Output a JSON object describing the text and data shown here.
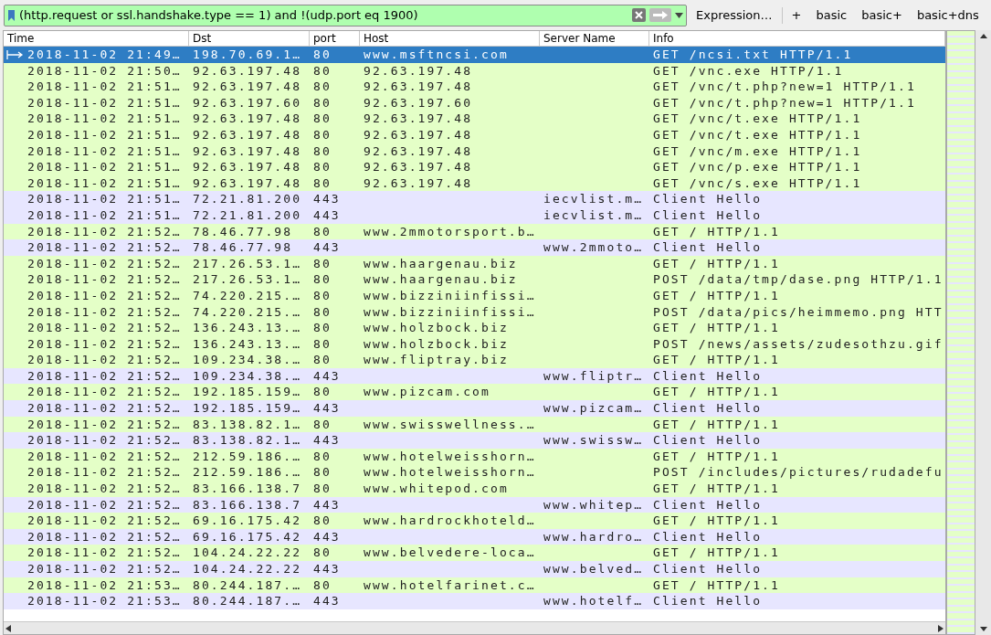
{
  "filter_bar": {
    "value": "(http.request or ssl.handshake.type == 1) and !(udp.port eq 1900)",
    "buttons": [
      {
        "label": "Expression…"
      },
      {
        "label": "+"
      },
      {
        "label": "basic"
      },
      {
        "label": "basic+"
      },
      {
        "label": "basic+dns"
      }
    ]
  },
  "table": {
    "columns": [
      "Time",
      "Dst",
      "port",
      "Host",
      "Server Name",
      "Info"
    ],
    "rows": [
      {
        "kind": "http",
        "selected": true,
        "cells": [
          "2018-11-02 21:49…",
          "198.70.69.1…",
          "80",
          "www.msftncsi.com",
          "",
          "GET /ncsi.txt HTTP/1.1"
        ]
      },
      {
        "kind": "http",
        "selected": false,
        "cells": [
          "2018-11-02 21:50…",
          "92.63.197.48",
          "80",
          "92.63.197.48",
          "",
          "GET /vnc.exe HTTP/1.1"
        ]
      },
      {
        "kind": "http",
        "selected": false,
        "cells": [
          "2018-11-02 21:51…",
          "92.63.197.48",
          "80",
          "92.63.197.48",
          "",
          "GET /vnc/t.php?new=1 HTTP/1.1"
        ]
      },
      {
        "kind": "http",
        "selected": false,
        "cells": [
          "2018-11-02 21:51…",
          "92.63.197.60",
          "80",
          "92.63.197.60",
          "",
          "GET /vnc/t.php?new=1 HTTP/1.1"
        ]
      },
      {
        "kind": "http",
        "selected": false,
        "cells": [
          "2018-11-02 21:51…",
          "92.63.197.48",
          "80",
          "92.63.197.48",
          "",
          "GET /vnc/t.exe HTTP/1.1"
        ]
      },
      {
        "kind": "http",
        "selected": false,
        "cells": [
          "2018-11-02 21:51…",
          "92.63.197.48",
          "80",
          "92.63.197.48",
          "",
          "GET /vnc/t.exe HTTP/1.1"
        ]
      },
      {
        "kind": "http",
        "selected": false,
        "cells": [
          "2018-11-02 21:51…",
          "92.63.197.48",
          "80",
          "92.63.197.48",
          "",
          "GET /vnc/m.exe HTTP/1.1"
        ]
      },
      {
        "kind": "http",
        "selected": false,
        "cells": [
          "2018-11-02 21:51…",
          "92.63.197.48",
          "80",
          "92.63.197.48",
          "",
          "GET /vnc/p.exe HTTP/1.1"
        ]
      },
      {
        "kind": "http",
        "selected": false,
        "cells": [
          "2018-11-02 21:51…",
          "92.63.197.48",
          "80",
          "92.63.197.48",
          "",
          "GET /vnc/s.exe HTTP/1.1"
        ]
      },
      {
        "kind": "tls",
        "selected": false,
        "cells": [
          "2018-11-02 21:51…",
          "72.21.81.200",
          "443",
          "",
          "iecvlist.m…",
          "Client Hello"
        ]
      },
      {
        "kind": "tls",
        "selected": false,
        "cells": [
          "2018-11-02 21:51…",
          "72.21.81.200",
          "443",
          "",
          "iecvlist.m…",
          "Client Hello"
        ]
      },
      {
        "kind": "http",
        "selected": false,
        "cells": [
          "2018-11-02 21:52…",
          "78.46.77.98",
          "80",
          "www.2mmotorsport.b…",
          "",
          "GET / HTTP/1.1"
        ]
      },
      {
        "kind": "tls",
        "selected": false,
        "cells": [
          "2018-11-02 21:52…",
          "78.46.77.98",
          "443",
          "",
          "www.2mmoto…",
          "Client Hello"
        ]
      },
      {
        "kind": "http",
        "selected": false,
        "cells": [
          "2018-11-02 21:52…",
          "217.26.53.1…",
          "80",
          "www.haargenau.biz",
          "",
          "GET / HTTP/1.1"
        ]
      },
      {
        "kind": "http",
        "selected": false,
        "cells": [
          "2018-11-02 21:52…",
          "217.26.53.1…",
          "80",
          "www.haargenau.biz",
          "",
          "POST /data/tmp/dase.png HTTP/1.1"
        ]
      },
      {
        "kind": "http",
        "selected": false,
        "cells": [
          "2018-11-02 21:52…",
          "74.220.215.…",
          "80",
          "www.bizziniinfissi…",
          "",
          "GET / HTTP/1.1"
        ]
      },
      {
        "kind": "http",
        "selected": false,
        "cells": [
          "2018-11-02 21:52…",
          "74.220.215.…",
          "80",
          "www.bizziniinfissi…",
          "",
          "POST /data/pics/heimmemo.png HTT"
        ]
      },
      {
        "kind": "http",
        "selected": false,
        "cells": [
          "2018-11-02 21:52…",
          "136.243.13.…",
          "80",
          "www.holzbock.biz",
          "",
          "GET / HTTP/1.1"
        ]
      },
      {
        "kind": "http",
        "selected": false,
        "cells": [
          "2018-11-02 21:52…",
          "136.243.13.…",
          "80",
          "www.holzbock.biz",
          "",
          "POST /news/assets/zudesothzu.gif"
        ]
      },
      {
        "kind": "http",
        "selected": false,
        "cells": [
          "2018-11-02 21:52…",
          "109.234.38.…",
          "80",
          "www.fliptray.biz",
          "",
          "GET / HTTP/1.1"
        ]
      },
      {
        "kind": "tls",
        "selected": false,
        "cells": [
          "2018-11-02 21:52…",
          "109.234.38.…",
          "443",
          "",
          "www.fliptr…",
          "Client Hello"
        ]
      },
      {
        "kind": "http",
        "selected": false,
        "cells": [
          "2018-11-02 21:52…",
          "192.185.159…",
          "80",
          "www.pizcam.com",
          "",
          "GET / HTTP/1.1"
        ]
      },
      {
        "kind": "tls",
        "selected": false,
        "cells": [
          "2018-11-02 21:52…",
          "192.185.159…",
          "443",
          "",
          "www.pizcam…",
          "Client Hello"
        ]
      },
      {
        "kind": "http",
        "selected": false,
        "cells": [
          "2018-11-02 21:52…",
          "83.138.82.1…",
          "80",
          "www.swisswellness.…",
          "",
          "GET / HTTP/1.1"
        ]
      },
      {
        "kind": "tls",
        "selected": false,
        "cells": [
          "2018-11-02 21:52…",
          "83.138.82.1…",
          "443",
          "",
          "www.swissw…",
          "Client Hello"
        ]
      },
      {
        "kind": "http",
        "selected": false,
        "cells": [
          "2018-11-02 21:52…",
          "212.59.186.…",
          "80",
          "www.hotelweisshorn…",
          "",
          "GET / HTTP/1.1"
        ]
      },
      {
        "kind": "http",
        "selected": false,
        "cells": [
          "2018-11-02 21:52…",
          "212.59.186.…",
          "80",
          "www.hotelweisshorn…",
          "",
          "POST /includes/pictures/rudadefu"
        ]
      },
      {
        "kind": "http",
        "selected": false,
        "cells": [
          "2018-11-02 21:52…",
          "83.166.138.7",
          "80",
          "www.whitepod.com",
          "",
          "GET / HTTP/1.1"
        ]
      },
      {
        "kind": "tls",
        "selected": false,
        "cells": [
          "2018-11-02 21:52…",
          "83.166.138.7",
          "443",
          "",
          "www.whitep…",
          "Client Hello"
        ]
      },
      {
        "kind": "http",
        "selected": false,
        "cells": [
          "2018-11-02 21:52…",
          "69.16.175.42",
          "80",
          "www.hardrockhoteld…",
          "",
          "GET / HTTP/1.1"
        ]
      },
      {
        "kind": "tls",
        "selected": false,
        "cells": [
          "2018-11-02 21:52…",
          "69.16.175.42",
          "443",
          "",
          "www.hardro…",
          "Client Hello"
        ]
      },
      {
        "kind": "http",
        "selected": false,
        "cells": [
          "2018-11-02 21:52…",
          "104.24.22.22",
          "80",
          "www.belvedere-loca…",
          "",
          "GET / HTTP/1.1"
        ]
      },
      {
        "kind": "tls",
        "selected": false,
        "cells": [
          "2018-11-02 21:52…",
          "104.24.22.22",
          "443",
          "",
          "www.belved…",
          "Client Hello"
        ]
      },
      {
        "kind": "http",
        "selected": false,
        "cells": [
          "2018-11-02 21:53…",
          "80.244.187.…",
          "80",
          "www.hotelfarinet.c…",
          "",
          "GET / HTTP/1.1"
        ]
      },
      {
        "kind": "tls",
        "selected": false,
        "cells": [
          "2018-11-02 21:53…",
          "80.244.187.…",
          "443",
          "",
          "www.hotelf…",
          "Client Hello"
        ]
      }
    ]
  }
}
